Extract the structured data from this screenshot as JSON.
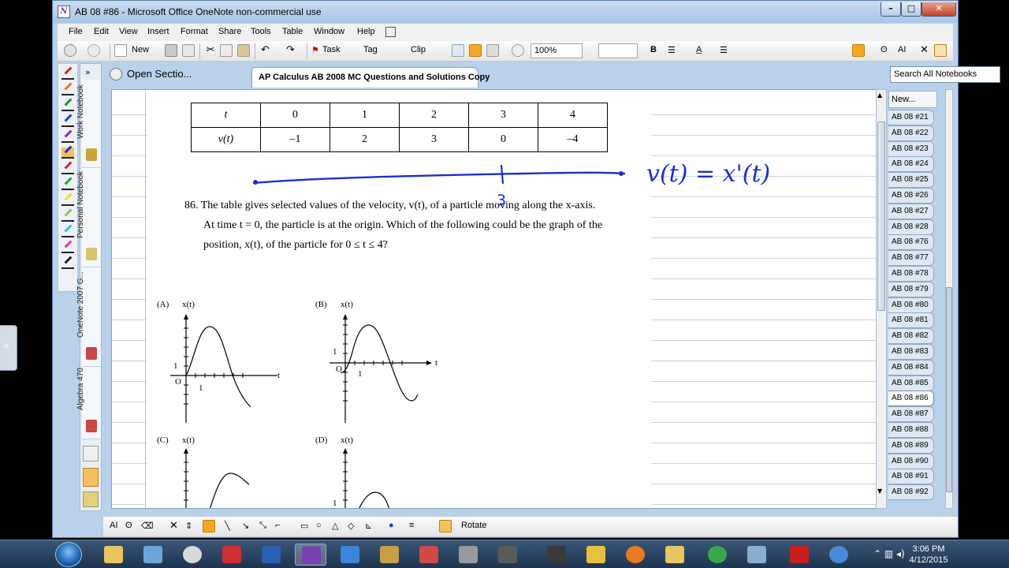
{
  "window": {
    "title": "AB 08 #86 - Microsoft Office OneNote non-commercial use"
  },
  "menu": [
    "File",
    "Edit",
    "View",
    "Insert",
    "Format",
    "Share",
    "Tools",
    "Table",
    "Window",
    "Help"
  ],
  "toolbar": {
    "new_label": "New",
    "task_label": "Task",
    "tag_label": "Tag",
    "clip_label": "Clip",
    "zoom": "100%"
  },
  "notebooks": [
    "Work Notebook",
    "Personal Notebook",
    "OneNote 2007 G...",
    "Algebra 470"
  ],
  "sections": {
    "open_label": "Open Sectio...",
    "active_tab": "AP Calculus AB 2008 MC Questions and Solutions Copy"
  },
  "search": {
    "placeholder": "Search All Notebooks"
  },
  "table": {
    "header": "t",
    "row_label": "v(t)",
    "t": [
      "0",
      "1",
      "2",
      "3",
      "4"
    ],
    "v": [
      "–1",
      "2",
      "3",
      "0",
      "–4"
    ]
  },
  "problem": {
    "line1": "86. The table gives selected values of the velocity, v(t), of a particle moving along the x-axis.",
    "line2": "At time t = 0, the particle is at the origin. Which of the following could be the graph of the",
    "line3": "position, x(t), of the particle for 0 ≤ t ≤ 4?"
  },
  "graphs": {
    "a_label": "(A)",
    "b_label": "(B)",
    "c_label": "(C)",
    "d_label": "(D)",
    "y_label": "x(t)",
    "x_label": "t",
    "origin": "O",
    "one": "1"
  },
  "ink": {
    "equation": "v(t) = x'(t)",
    "mark": "3"
  },
  "page_tabs": {
    "new_label": "New...",
    "items": [
      "AB 08 #21",
      "AB 08 #22",
      "AB 08 #23",
      "AB 08 #24",
      "AB 08 #25",
      "AB 08 #26",
      "AB 08 #27",
      "AB 08 #28",
      "AB 08 #76",
      "AB 08 #77",
      "AB 08 #78",
      "AB 08 #79",
      "AB 08 #80",
      "AB 08 #81",
      "AB 08 #82",
      "AB 08 #83",
      "AB 08 #84",
      "AB 08 #85",
      "AB 08 #86",
      "AB 08 #87",
      "AB 08 #88",
      "AB 08 #89",
      "AB 08 #90",
      "AB 08 #91",
      "AB 08 #92"
    ],
    "active": "AB 08 #86"
  },
  "drawbar": {
    "rotate_label": "Rotate"
  },
  "taskbar": {
    "time": "3:06 PM",
    "date": "4/12/2015"
  },
  "colors": {
    "ink": "#1a2fd0",
    "accent": "#f5a623"
  }
}
